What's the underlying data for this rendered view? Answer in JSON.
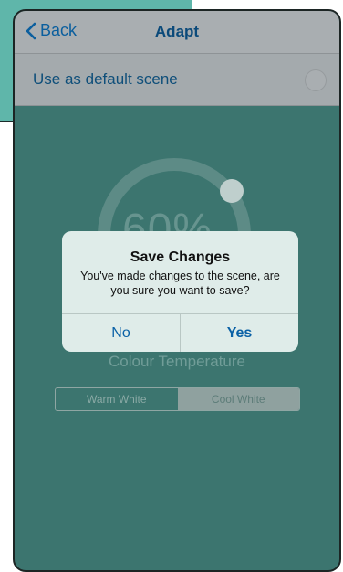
{
  "navbar": {
    "back_label": "Back",
    "title": "Adapt"
  },
  "default_scene": {
    "label": "Use as default scene",
    "selected": false
  },
  "dial": {
    "brightness_text": "60%",
    "value_fraction": 0.6
  },
  "colour_temperature": {
    "label": "Colour Temperature",
    "options": [
      "Warm White",
      "Cool White"
    ],
    "selected": "Cool White"
  },
  "alert": {
    "title": "Save Changes",
    "message": "You've made changes to the scene, are you sure you want to save?",
    "no_label": "No",
    "yes_label": "Yes"
  },
  "colors": {
    "background_teal": "#3c756f",
    "card_teal": "#5fb6aa",
    "ios_blue": "#0b5f9e"
  }
}
